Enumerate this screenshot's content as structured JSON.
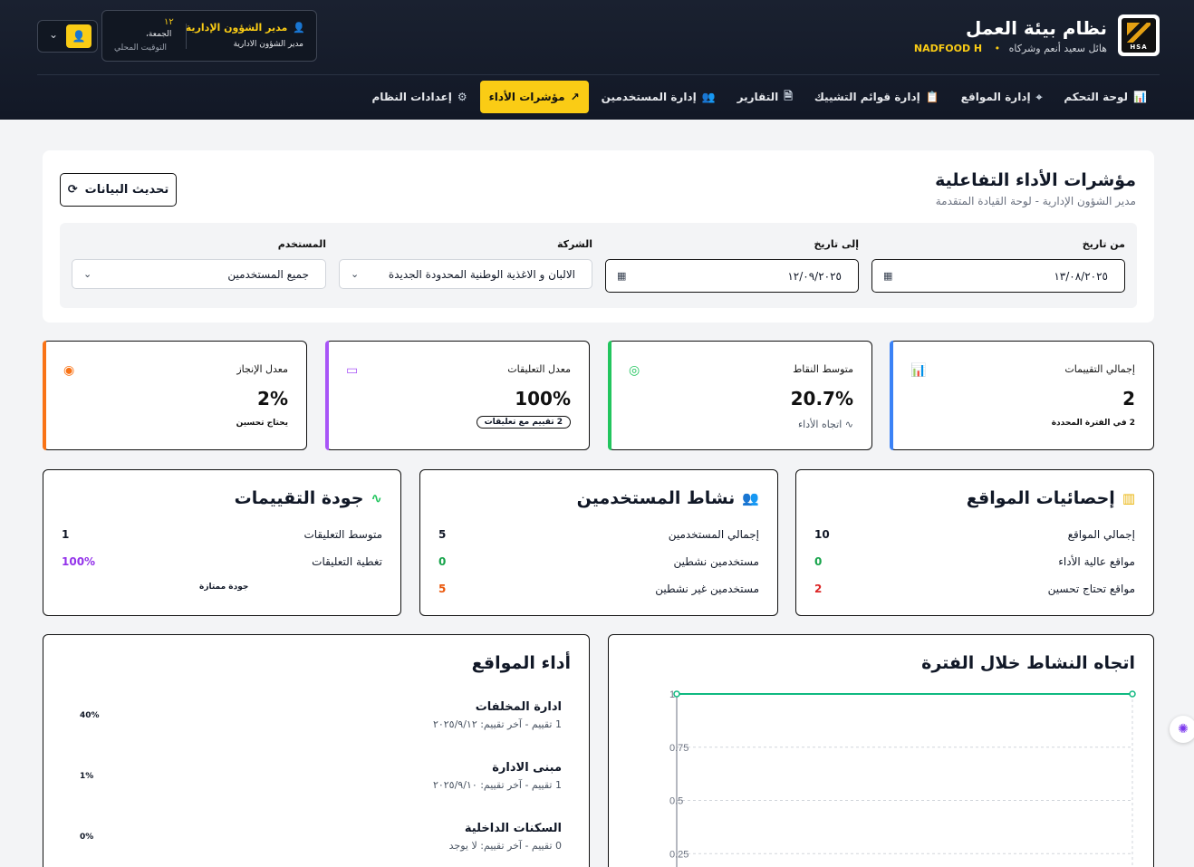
{
  "brand": {
    "title": "نظام بيئة العمل",
    "company": "هائل سعيد أنعم وشركاه",
    "code": "NADFOOD H",
    "logo_text": "HSA"
  },
  "user": {
    "role": "مدير الشؤون الإدارية",
    "role_sub": "مدير الشؤون الادارية",
    "time_number": "١٢",
    "time_day": "الجمعة،",
    "time_label": "التوقيت المحلي"
  },
  "nav": [
    {
      "label": "لوحة التحكم",
      "icon": "📊",
      "active": false
    },
    {
      "label": "إدارة المواقع",
      "icon": "⌖",
      "active": false
    },
    {
      "label": "إدارة قوائم التشييك",
      "icon": "📋",
      "active": false
    },
    {
      "label": "التقارير",
      "icon": "🗎",
      "active": false
    },
    {
      "label": "إدارة المستخدمين",
      "icon": "👥",
      "active": false
    },
    {
      "label": "مؤشرات الأداء",
      "icon": "↗",
      "active": true
    },
    {
      "label": "إعدادات النظام",
      "icon": "⚙",
      "active": false
    }
  ],
  "page": {
    "title": "مؤشرات الأداء التفاعلية",
    "subtitle": "مدير الشؤون الإدارية - لوحة القيادة المتقدمة",
    "refresh_label": "تحديث البيانات"
  },
  "filters": {
    "from_label": "من تاريخ",
    "from_value": "١٣/٠٨/٢٠٢٥",
    "to_label": "إلى تاريخ",
    "to_value": "١٢/٠٩/٢٠٢٥",
    "company_label": "الشركة",
    "company_value": "الالبان و الاغذية الوطنية المحدودة الجديدة",
    "user_label": "المستخدم",
    "user_value": "جميع المستخدمين"
  },
  "kpis": {
    "total": {
      "label": "إجمالي التقييمات",
      "value": "2",
      "note": "2 في الفترة المحددة",
      "color": "#3b82f6"
    },
    "avg": {
      "label": "متوسط النقاط",
      "value": "20.7%",
      "note": "اتجاه الأداء",
      "color": "#22c55e"
    },
    "comments": {
      "label": "معدل التعليقات",
      "value": "100%",
      "note": "2 تقييم مع تعليقات",
      "color": "#a855f7"
    },
    "completion": {
      "label": "معدل الإنجاز",
      "value": "2%",
      "note": "يحتاج تحسين",
      "color": "#f97316"
    }
  },
  "sites_stats": {
    "title": "إحصائيات المواقع",
    "rows": [
      {
        "label": "إجمالي المواقع",
        "value": "10",
        "color": "#111827"
      },
      {
        "label": "مواقع عالية الأداء",
        "value": "0",
        "color": "#16a34a"
      },
      {
        "label": "مواقع تحتاج تحسين",
        "value": "2",
        "color": "#dc2626"
      }
    ]
  },
  "users_activity": {
    "title": "نشاط المستخدمين",
    "rows": [
      {
        "label": "إجمالي المستخدمين",
        "value": "5",
        "color": "#111827"
      },
      {
        "label": "مستخدمين نشطين",
        "value": "0",
        "color": "#16a34a"
      },
      {
        "label": "مستخدمين غير نشطين",
        "value": "5",
        "color": "#ea580c"
      }
    ]
  },
  "quality": {
    "title": "جودة التقييمات",
    "rows": [
      {
        "label": "متوسط التعليقات",
        "value": "1",
        "color": "#111827"
      },
      {
        "label": "تغطية التعليقات",
        "value": "100%",
        "color": "#9333ea"
      }
    ],
    "note": "جودة ممتازة"
  },
  "trend": {
    "title": "اتجاه النشاط خلال الفترة"
  },
  "sites_perf": {
    "title": "أداء المواقع",
    "items": [
      {
        "name": "ادارة المخلفات",
        "meta": "1 تقييم - آخر تقييم: ٢٠٢٥/٩/١٢",
        "pct": "40%"
      },
      {
        "name": "مبنى الادارة",
        "meta": "1 تقييم - آخر تقييم: ٢٠٢٥/٩/١٠",
        "pct": "1%"
      },
      {
        "name": "السكنات الداخلية",
        "meta": "0 تقييم - آخر تقييم: لا يوجد",
        "pct": "0%"
      }
    ]
  },
  "chart_data": {
    "type": "line",
    "title": "اتجاه النشاط خلال الفترة",
    "ylim": [
      0,
      1
    ],
    "yticks": [
      "1",
      "0.75",
      "0.5",
      "0.25"
    ],
    "grid": true,
    "series": [
      {
        "values": [
          1,
          1
        ],
        "color": "#10b981"
      }
    ]
  }
}
